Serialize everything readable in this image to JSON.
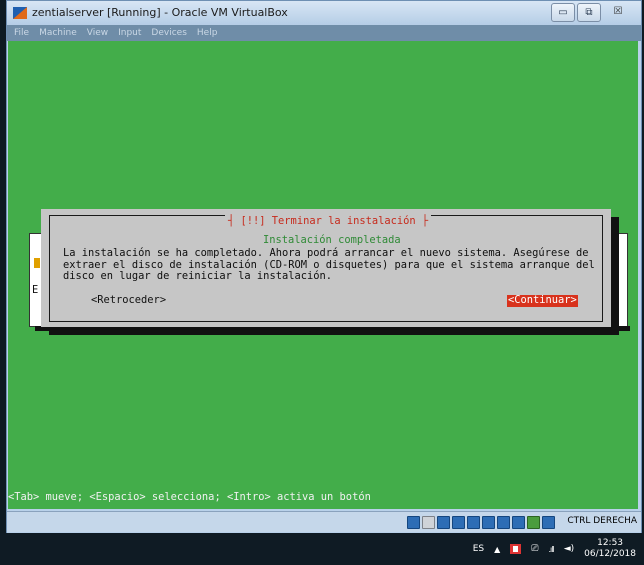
{
  "window": {
    "title": "zentialserver [Running] - Oracle VM VirtualBox",
    "controls": {
      "minimize": "▭",
      "maximize": "⧉",
      "close": "☒"
    }
  },
  "menu": [
    "File",
    "Machine",
    "View",
    "Input",
    "Devices",
    "Help"
  ],
  "installer": {
    "dialog_title": "┤ [!!] Terminar la instalación ├",
    "subtitle": "Instalación completada",
    "body": "La instalación se ha completado. Ahora podrá arrancar el nuevo sistema. Asegúrese de\nextraer el disco de instalación (CD-ROM o disquetes) para que el sistema arranque del\ndisco en lugar de reiniciar la instalación.",
    "back_button": "<Retroceder>",
    "continue_button": "<Continuar>",
    "background_letter": "E",
    "help_line": "<Tab> mueve; <Espacio> selecciona; <Intro> activa un botón",
    "colors": {
      "screen": "#43ad4a",
      "dialog": "#c6c6c6",
      "title": "#c62a1c",
      "subtitle": "#2f8a36",
      "selected_button": "#d8321c"
    }
  },
  "statusbar": {
    "icons": [
      "disk-icon",
      "optical-icon",
      "usb-icon",
      "shared-folder-icon",
      "display-icon",
      "network-icon",
      "recording-icon",
      "cpu-icon",
      "mouse-integration-icon",
      "host-key-icon"
    ],
    "host_key": "CTRL DERECHA"
  },
  "taskbar": {
    "language": "ES",
    "time": "12:53",
    "date": "06/12/2018"
  }
}
